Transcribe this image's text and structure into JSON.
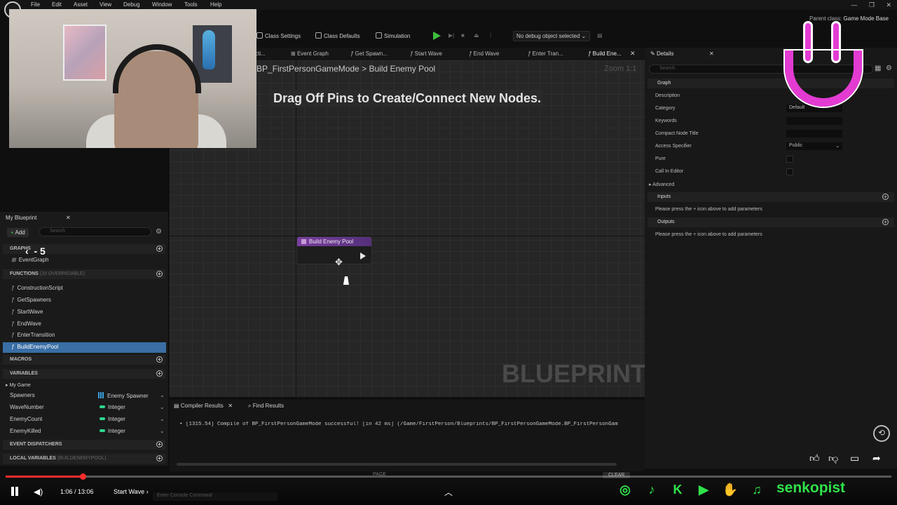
{
  "menu": [
    "File",
    "Edit",
    "Asset",
    "View",
    "Debug",
    "Window",
    "Tools",
    "Help"
  ],
  "window_controls": [
    "—",
    "❐",
    "✕"
  ],
  "parent_class": {
    "label": "Parent class:",
    "value": "Game Mode Base"
  },
  "toolbar": {
    "class_settings": "Class Settings",
    "class_defaults": "Class Defaults",
    "simulation": "Simulation",
    "debug_object": "No debug object selected"
  },
  "tabs": [
    "ructi...",
    "Event Graph",
    "Get Spawn...",
    "Start Wave",
    "End Wave",
    "Enter Tran...",
    "Build Ene..."
  ],
  "breadcrumb": {
    "parent": "BP_FirstPersonGameMode",
    "separator": ">",
    "current": "Build Enemy Pool"
  },
  "zoom": "Zoom 1:1",
  "graph": {
    "hint": "Drag Off Pins to Create/Connect New Nodes.",
    "watermark": "BLUEPRINT",
    "node_title": "Build Enemy Pool"
  },
  "compiler": {
    "tab_results": "Compiler Results",
    "tab_find": "Find Results",
    "message": "• [1315.54] Compile of BP_FirstPersonGameMode successful! [in 42 ms] (/Game/FirstPerson/Blueprints/BP_FirstPersonGameMode.BP_FirstPersonGam",
    "page": "PAGE",
    "clear": "CLEAR"
  },
  "my_blueprint": {
    "title": "My Blueprint",
    "add": "Add",
    "search_placeholder": "Search",
    "graphs": "GRAPHS",
    "event_graph": "EventGraph",
    "functions": "FUNCTIONS",
    "functions_count": "(33 OVERRIDABLE)",
    "function_items": [
      "ConstructionScript",
      "GetSpawners",
      "StartWave",
      "EndWave",
      "EnterTransition",
      "BuildEnemyPool"
    ],
    "macros": "MACROS",
    "variables": "VARIABLES",
    "category": "My Game",
    "variable_items": [
      {
        "name": "Spawners",
        "type": "Enemy Spawner"
      },
      {
        "name": "WaveNumber",
        "type": "Integer"
      },
      {
        "name": "EnemyCount",
        "type": "Integer"
      },
      {
        "name": "EnemyKilled",
        "type": "Integer"
      }
    ],
    "event_dispatchers": "EVENT DISPATCHERS",
    "local_variables": "LOCAL VARIABLES",
    "local_variables_scope": "(BUILDENEMYPOOL)"
  },
  "details": {
    "title": "Details",
    "search_placeholder": "Search",
    "graph_section": "Graph",
    "labels": [
      "Description",
      "Category",
      "Keywords",
      "Compact Node Title",
      "Access Specifier",
      "Pure",
      "Call In Editor"
    ],
    "category_value": "Default",
    "access_value": "Public",
    "advanced": "Advanced",
    "inputs": "Inputs",
    "inputs_hint": "Please press the + icon above to add parameters",
    "outputs": "Outputs",
    "outputs_hint": "Please press the + icon above to add parameters"
  },
  "player": {
    "skip": "- 5",
    "time": "1:06 / 13:06",
    "chapter": "Start Wave",
    "progress": 0.084,
    "console_placeholder": "Enter Console Command",
    "channel": "senkopist"
  },
  "colors": {
    "accent": "#3a6ea5",
    "brand_green": "#2fe24a",
    "smile_pink": "#e33bd2",
    "progress_red": "#ff2d2d"
  }
}
